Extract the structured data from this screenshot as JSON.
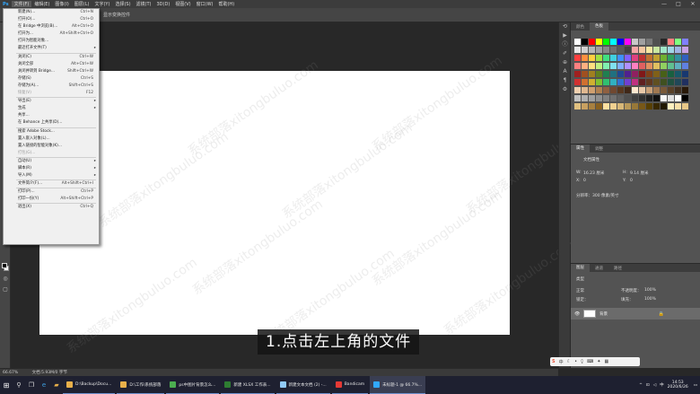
{
  "menubar": {
    "items": [
      "文件(F)",
      "编辑(E)",
      "图像(I)",
      "图层(L)",
      "文字(Y)",
      "选择(S)",
      "滤镜(T)",
      "3D(D)",
      "视图(V)",
      "窗口(W)",
      "帮助(H)"
    ],
    "active": "文件(F)"
  },
  "options_bar": {
    "text": "显示变换控件"
  },
  "file_menu": {
    "groups": [
      [
        {
          "label": "新建(N)...",
          "shortcut": "Ctrl+N"
        },
        {
          "label": "打开(O)...",
          "shortcut": "Ctrl+O"
        },
        {
          "label": "在 Bridge 中浏览(B)...",
          "shortcut": "Alt+Ctrl+O"
        },
        {
          "label": "打开为...",
          "shortcut": "Alt+Shift+Ctrl+O"
        },
        {
          "label": "打开为智能对象...",
          "shortcut": ""
        },
        {
          "label": "最近打开文件(T)",
          "shortcut": "",
          "submenu": true
        }
      ],
      [
        {
          "label": "关闭(C)",
          "shortcut": "Ctrl+W"
        },
        {
          "label": "关闭全部",
          "shortcut": "Alt+Ctrl+W"
        },
        {
          "label": "关闭并转到 Bridge...",
          "shortcut": "Shift+Ctrl+W"
        },
        {
          "label": "存储(S)",
          "shortcut": "Ctrl+S"
        },
        {
          "label": "存储为(A)...",
          "shortcut": "Shift+Ctrl+S"
        },
        {
          "label": "恢复(V)",
          "shortcut": "F12",
          "disabled": true
        }
      ],
      [
        {
          "label": "导出(E)",
          "shortcut": "",
          "submenu": true
        },
        {
          "label": "生成",
          "shortcut": "",
          "submenu": true
        },
        {
          "label": "共享...",
          "shortcut": ""
        },
        {
          "label": "在 Behance 上共享(D)...",
          "shortcut": ""
        }
      ],
      [
        {
          "label": "搜索 Adobe Stock...",
          "shortcut": ""
        },
        {
          "label": "置入嵌入对象(L)...",
          "shortcut": ""
        },
        {
          "label": "置入链接的智能对象(K)...",
          "shortcut": ""
        },
        {
          "label": "打包(G)...",
          "shortcut": "",
          "disabled": true
        }
      ],
      [
        {
          "label": "自动(U)",
          "shortcut": "",
          "submenu": true
        },
        {
          "label": "脚本(R)",
          "shortcut": "",
          "submenu": true
        },
        {
          "label": "导入(M)",
          "shortcut": "",
          "submenu": true
        }
      ],
      [
        {
          "label": "文件简介(F)...",
          "shortcut": "Alt+Shift+Ctrl+I"
        }
      ],
      [
        {
          "label": "打印(P)...",
          "shortcut": "Ctrl+P"
        },
        {
          "label": "打印一份(Y)",
          "shortcut": "Alt+Shift+Ctrl+P"
        }
      ],
      [
        {
          "label": "退出(X)",
          "shortcut": "Ctrl+Q"
        }
      ]
    ]
  },
  "caption": "1.点击左上角的文件",
  "watermark": "系统部落xitongbuluo.com",
  "panels": {
    "swatch_tabs": [
      "颜色",
      "色板"
    ],
    "swatch_active": "色板",
    "props_tabs": [
      "属性",
      "调整"
    ],
    "props_active": "属性",
    "doc_props_label": "文档属性",
    "width_label": "W:",
    "width_value": "16.23 厘米",
    "height_label": "H:",
    "height_value": "9.14 厘米",
    "x_label": "X:",
    "x_value": "0",
    "y_label": "Y:",
    "y_value": "0",
    "resolution": "分辨率：300 像素/英寸",
    "layers_tabs": [
      "图层",
      "通道",
      "路径"
    ],
    "layers_active": "图层",
    "layer_kind": "类型",
    "blend_mode": "正常",
    "opacity_label": "不透明度：",
    "opacity_value": "100%",
    "lock_label": "锁定：",
    "fill_label": "填充：",
    "fill_value": "100%",
    "layer_name": "背景"
  },
  "status": {
    "zoom": "66.67%",
    "doc": "文档:5.93M/0 字节"
  },
  "taskbar": {
    "apps": [
      {
        "label": "D:\\Backup\\Docu...",
        "color": "#e8b04a"
      },
      {
        "label": "D:\\工作\\系统部落",
        "color": "#e8b04a"
      },
      {
        "label": "ps中图片背景怎么...",
        "color": "#4caf50"
      },
      {
        "label": "新建 XLSX 工作表...",
        "color": "#2e7d32"
      },
      {
        "label": "新建文本文档 (2) -...",
        "color": "#90caf9"
      },
      {
        "label": "Bandicam",
        "color": "#e53935"
      },
      {
        "label": "未标题-1 @ 66.7%...",
        "color": "#31a8ff",
        "active": true
      }
    ],
    "time": "14:53",
    "date": "2020/6/26",
    "lang": "中"
  },
  "colors": {
    "accent": "#31a8ff",
    "menubar": "#3c3c3c",
    "panel": "#535353",
    "canvas_bg": "#282828"
  }
}
